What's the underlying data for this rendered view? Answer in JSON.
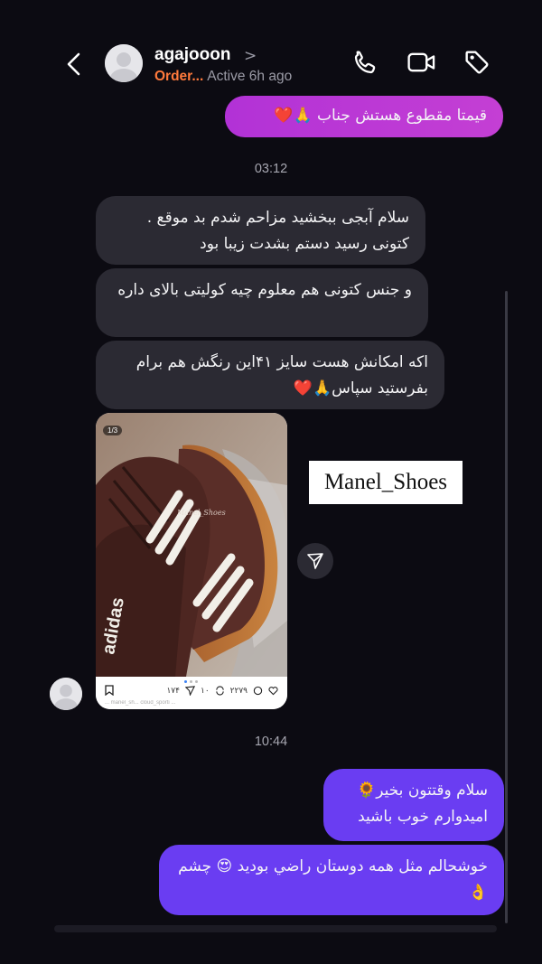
{
  "header": {
    "back_icon": "chevron-left-icon",
    "username": "agajooon",
    "username_chevron": ">",
    "order_label": "Order...",
    "status": "Active 6h ago",
    "icons": [
      "phone-icon",
      "video-icon",
      "tag-icon"
    ]
  },
  "messages": {
    "m0": "قیمتا مقطوع هستش جناب 🙏❤️",
    "ts1": "03:12",
    "m1": "سلام آبجی ببخشید مزاحم شدم بد موقع . کتونی رسید دستم بشدت زیبا بود",
    "m2": "و جنس کتونی هم معلوم چیه کولیتی بالای داره",
    "m3": "اکه امکانش هست سایز ۴۱این رنگش هم برام بفرستید سپاس🙏❤️",
    "ts2": "10:44",
    "m4": "سلام وقتتون بخیر🌻 امیدوارم خوب باشید",
    "m5": "خوشحالم مثل همه دوستان راضي بوديد 😍 چشم👌"
  },
  "post": {
    "counter": "1/3",
    "image_watermark": "Manel_Shoes",
    "likes": "۲۲۷۹",
    "comments": "۱۰",
    "shares": "۱۷۴",
    "caption": "... manel_sh... cloud_sporti ..."
  },
  "overlay_watermark": "Manel_Shoes",
  "colors": {
    "background": "#0c0b12",
    "incoming_bubble": "#2b2a33",
    "outgoing_pink": "#c43fd4",
    "outgoing_purple": "#6a3df2",
    "order_accent": "#ff7a3c"
  }
}
